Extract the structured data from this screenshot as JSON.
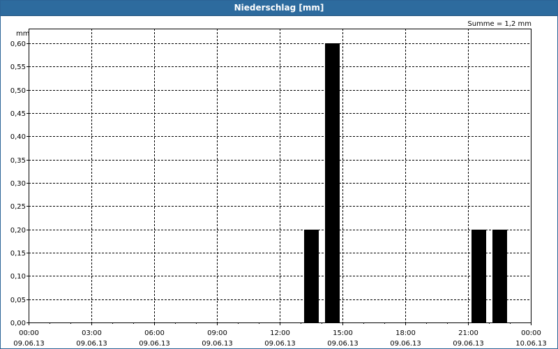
{
  "window": {
    "title": "Niederschlag [mm]"
  },
  "summary": "Summe = 1,2 mm",
  "colors": {
    "titlebar": "#2d6b9e",
    "bar": "#000000",
    "grid": "#000000"
  },
  "chart_data": {
    "type": "bar",
    "ylabel": "mm",
    "ylim": [
      0,
      0.6
    ],
    "ytick_step": 0.05,
    "ytick_labels": [
      "0,00",
      "0,05",
      "0,10",
      "0,15",
      "0,20",
      "0,25",
      "0,30",
      "0,35",
      "0,40",
      "0,45",
      "0,50",
      "0,55",
      "0,60"
    ],
    "xlim": [
      "09.06.13 00:00",
      "10.06.13 00:00"
    ],
    "xtick_hours": [
      0,
      3,
      6,
      9,
      12,
      15,
      18,
      21,
      24
    ],
    "xtick_labels": [
      {
        "time": "00:00",
        "date": "09.06.13"
      },
      {
        "time": "03:00",
        "date": "09.06.13"
      },
      {
        "time": "06:00",
        "date": "09.06.13"
      },
      {
        "time": "09:00",
        "date": "09.06.13"
      },
      {
        "time": "12:00",
        "date": "09.06.13"
      },
      {
        "time": "15:00",
        "date": "09.06.13"
      },
      {
        "time": "18:00",
        "date": "09.06.13"
      },
      {
        "time": "21:00",
        "date": "09.06.13"
      },
      {
        "time": "00:00",
        "date": "10.06.13"
      }
    ],
    "bars": [
      {
        "x": "09.06.13 13:00",
        "hour": 13,
        "value": 0.2
      },
      {
        "x": "09.06.13 14:00",
        "hour": 14,
        "value": 0.6
      },
      {
        "x": "09.06.13 21:00",
        "hour": 21,
        "value": 0.2
      },
      {
        "x": "09.06.13 22:00",
        "hour": 22,
        "value": 0.2
      }
    ],
    "grid": true
  }
}
